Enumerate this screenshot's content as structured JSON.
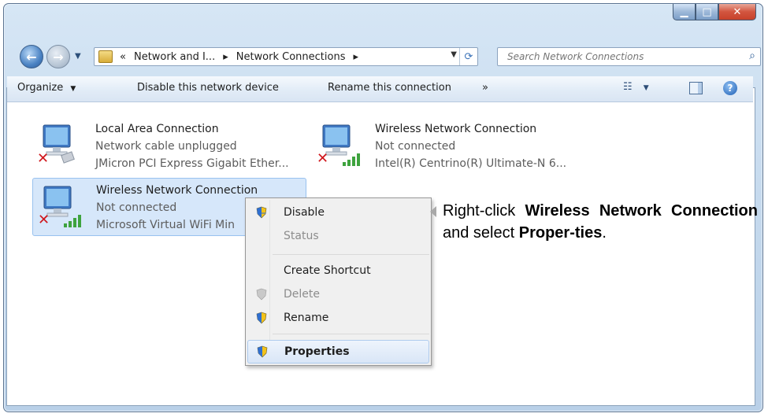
{
  "window": {
    "controls": {
      "minimize_icon": "minimize-icon",
      "maximize_icon": "maximize-icon",
      "close_icon": "close-icon"
    }
  },
  "address": {
    "overflow": "«",
    "crumbs": [
      "Network and I...",
      "Network Connections"
    ],
    "separator": "▸",
    "search_placeholder": "Search Network Connections"
  },
  "toolbar": {
    "organize": "Organize",
    "disable": "Disable this network device",
    "rename": "Rename this connection",
    "more": "»"
  },
  "connections": [
    {
      "title": "Local Area Connection",
      "status": "Network cable unplugged",
      "device": "JMicron PCI Express Gigabit Ether..."
    },
    {
      "title": "Wireless Network Connection",
      "status": "Not connected",
      "device": "Intel(R) Centrino(R) Ultimate-N 6..."
    },
    {
      "title": "Wireless Network Connection",
      "status": "Not connected",
      "device": "Microsoft Virtual WiFi Min"
    }
  ],
  "context_menu": {
    "items": [
      {
        "label": "Disable",
        "enabled": true,
        "bold": false,
        "shield": true
      },
      {
        "label": "Status",
        "enabled": false,
        "bold": false,
        "shield": false
      },
      {
        "label": "Create Shortcut",
        "enabled": true,
        "bold": false,
        "shield": false
      },
      {
        "label": "Delete",
        "enabled": false,
        "bold": false,
        "shield": true
      },
      {
        "label": "Rename",
        "enabled": true,
        "bold": false,
        "shield": true
      },
      {
        "label": "Properties",
        "enabled": true,
        "bold": true,
        "shield": true
      }
    ]
  },
  "callout": {
    "p1": "Right-click ",
    "b1": "Wireless Network Connection",
    "p2": " and select ",
    "b2": "Proper-ties",
    "p3": "."
  },
  "colors": {
    "selection": "#d6e7fa",
    "menu_bg": "#f0f0f0",
    "window_frame": "#c2d7ec"
  }
}
